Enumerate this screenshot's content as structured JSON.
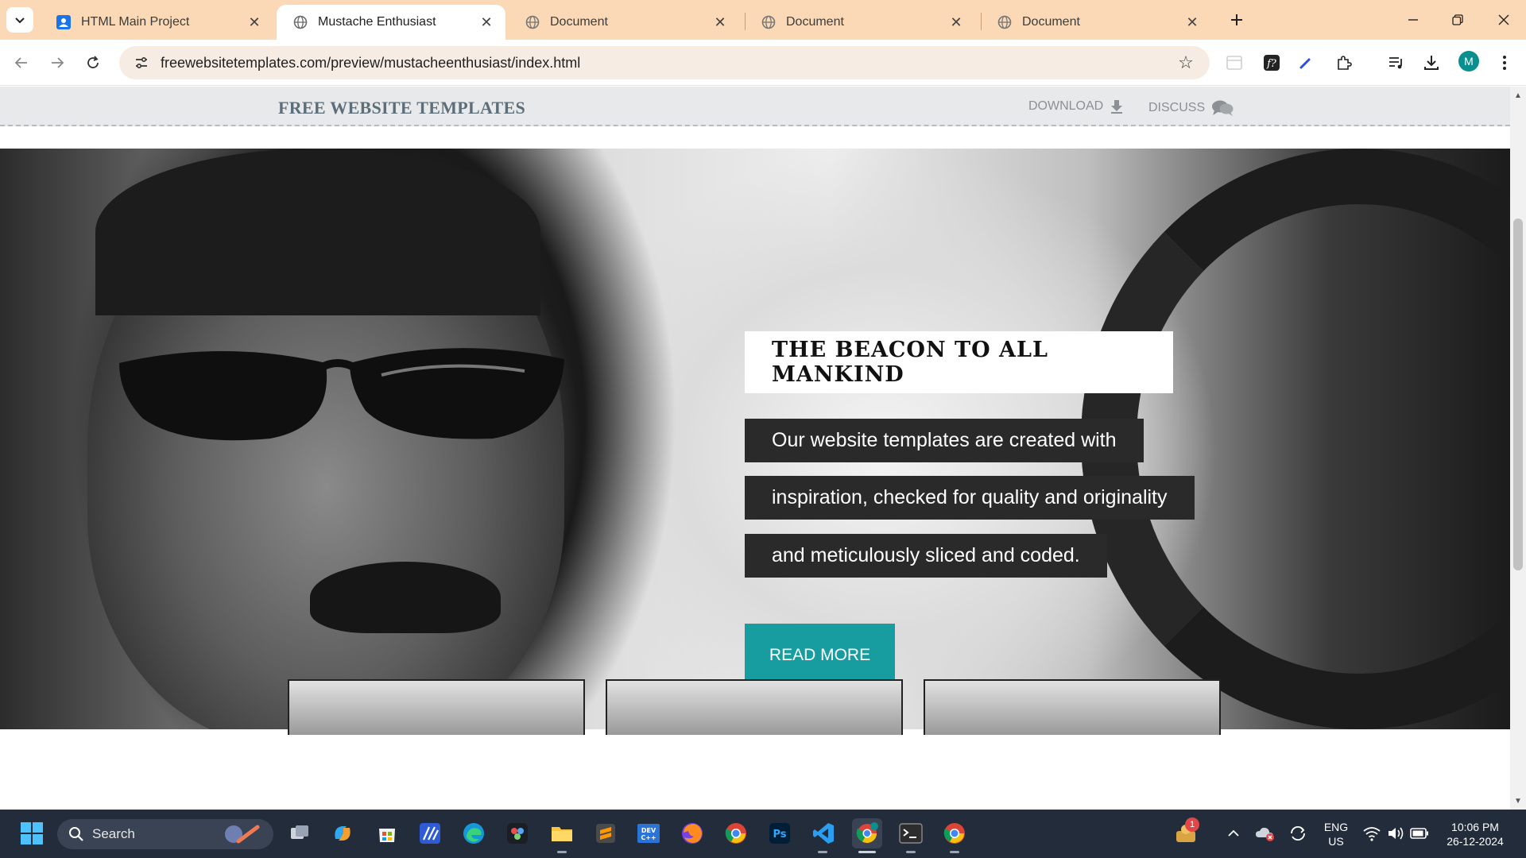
{
  "browser": {
    "tabs": [
      {
        "label": "HTML Main Project",
        "active": false
      },
      {
        "label": "Mustache Enthusiast",
        "active": true
      },
      {
        "label": "Document",
        "active": false
      },
      {
        "label": "Document",
        "active": false
      },
      {
        "label": "Document",
        "active": false
      }
    ],
    "address": "freewebsitetemplates.com/preview/mustacheenthusiast/index.html",
    "profile_initial": "M",
    "accent_color": "#fbd9b6"
  },
  "site": {
    "logo": "FREE WEBSITE TEMPLATES",
    "download_label": "DOWNLOAD",
    "discuss_label": "DISCUSS"
  },
  "hero": {
    "title": "THE BEACON TO ALL MANKIND",
    "lines": [
      "Our website templates are created with",
      "inspiration, checked for quality and originality",
      "and meticulously sliced and coded."
    ],
    "button_label": "READ MORE",
    "button_color": "#179d9f"
  },
  "taskbar": {
    "search_label": "Search",
    "notification_count": "1",
    "lang_primary": "ENG",
    "lang_secondary": "US",
    "time": "10:06 PM",
    "date": "26-12-2024"
  }
}
